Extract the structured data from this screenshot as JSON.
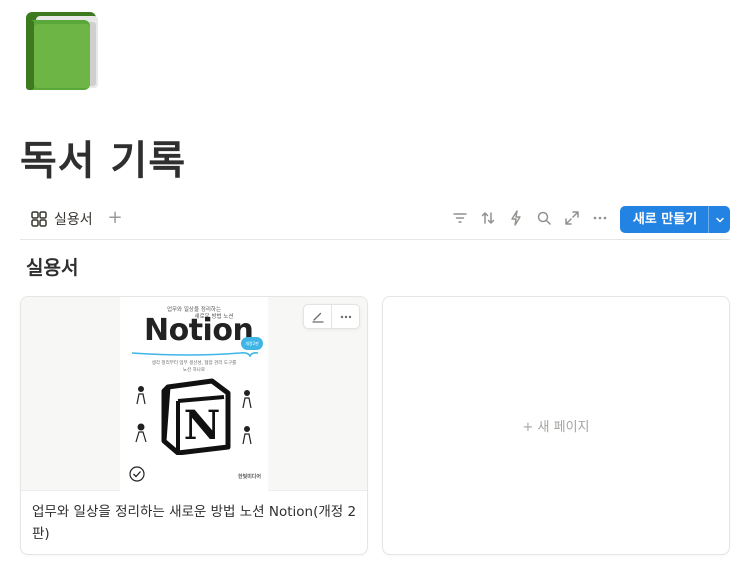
{
  "page": {
    "icon": "green-book-icon",
    "title": "독서 기록"
  },
  "toolbar": {
    "view_tab_icon": "gallery-grid-icon",
    "view_tab_label": "실용서",
    "add_view_label": "+",
    "tools": [
      "filter-icon",
      "sort-icon",
      "automation-bolt-icon",
      "search-icon",
      "expand-icon",
      "more-icon"
    ],
    "new_button_label": "새로 만들기",
    "accent_color": "#2383e2"
  },
  "group": {
    "heading": "실용서"
  },
  "cards": [
    {
      "title": "업무와 일상을 정리하는 새로운 방법 노션 Notion(개정 2판)",
      "cover": {
        "kicker": "업무와 일상을 정리하는",
        "subtitle": "새로운 방법 노션",
        "logo_text": "Notion",
        "badge": "개정2판",
        "tagline_1": "생각 정리부터 업무 생산성, 협업 관리 도구를",
        "tagline_2": "노션 하나로",
        "publisher": "한빛미디어"
      },
      "actions": [
        "edit-icon",
        "more-icon"
      ]
    },
    {
      "new_page_label": "+  새 페이지"
    }
  ]
}
